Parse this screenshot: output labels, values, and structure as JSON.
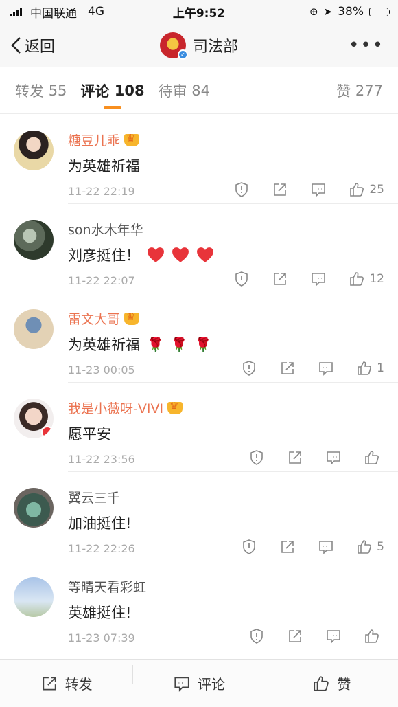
{
  "status_bar": {
    "carrier": "中国联通",
    "network": "4G",
    "time": "上午9:52",
    "battery": "38%",
    "battery_level": 0.38
  },
  "nav": {
    "back_label": "返回",
    "title": "司法部"
  },
  "tabs": [
    {
      "label": "转发",
      "count": "55"
    },
    {
      "label": "评论",
      "count": "108"
    },
    {
      "label": "待审",
      "count": "84"
    },
    {
      "label": "赞",
      "count": "277"
    }
  ],
  "comments": [
    {
      "username": "糖豆儿乖",
      "text": "为英雄祈福",
      "time": "11-22 22:19",
      "likes": "25"
    },
    {
      "username": "son水木年华",
      "text": "刘彦挺住！",
      "time": "11-22 22:07",
      "likes": "12"
    },
    {
      "username": "雷文大哥",
      "text": "为英雄祈福",
      "time": "11-23 00:05",
      "likes": "1"
    },
    {
      "username": "我是小薇呀-VIVI",
      "text": "愿平安",
      "time": "11-22 23:56",
      "likes": ""
    },
    {
      "username": "翼云三千",
      "text": "加油挺住!",
      "time": "11-22 22:26",
      "likes": "5"
    },
    {
      "username": "等晴天看彩虹",
      "text": "英雄挺住!",
      "time": "11-23 07:39",
      "likes": ""
    }
  ],
  "toolbar": {
    "repost": "转发",
    "comment": "评论",
    "like": "赞"
  },
  "colors": {
    "accent": "#f88f1f",
    "vip_name": "#eb7350",
    "heart": "#e8343a"
  },
  "icons": [
    "report-icon",
    "share-icon",
    "reply-icon",
    "thumbs-up-icon"
  ]
}
